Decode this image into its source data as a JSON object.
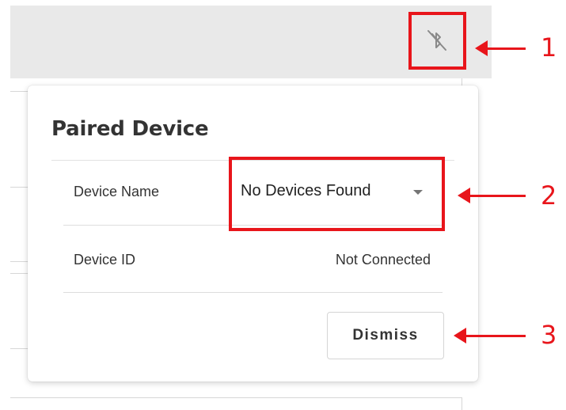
{
  "toolbar": {
    "bluetooth_icon": "bluetooth-disabled-icon"
  },
  "dialog": {
    "title": "Paired Device",
    "device_name_label": "Device Name",
    "device_name_value": "No Devices Found",
    "device_id_label": "Device ID",
    "device_id_value": "Not Connected",
    "dismiss_label": "Dismiss"
  },
  "callouts": [
    {
      "number": "1",
      "target": "bluetooth-toggle-button"
    },
    {
      "number": "2",
      "target": "device-name-select"
    },
    {
      "number": "3",
      "target": "dismiss-button"
    }
  ],
  "colors": {
    "callout": "#e8151b",
    "toolbar_background": "#e9e9e9",
    "text": "#333333"
  }
}
